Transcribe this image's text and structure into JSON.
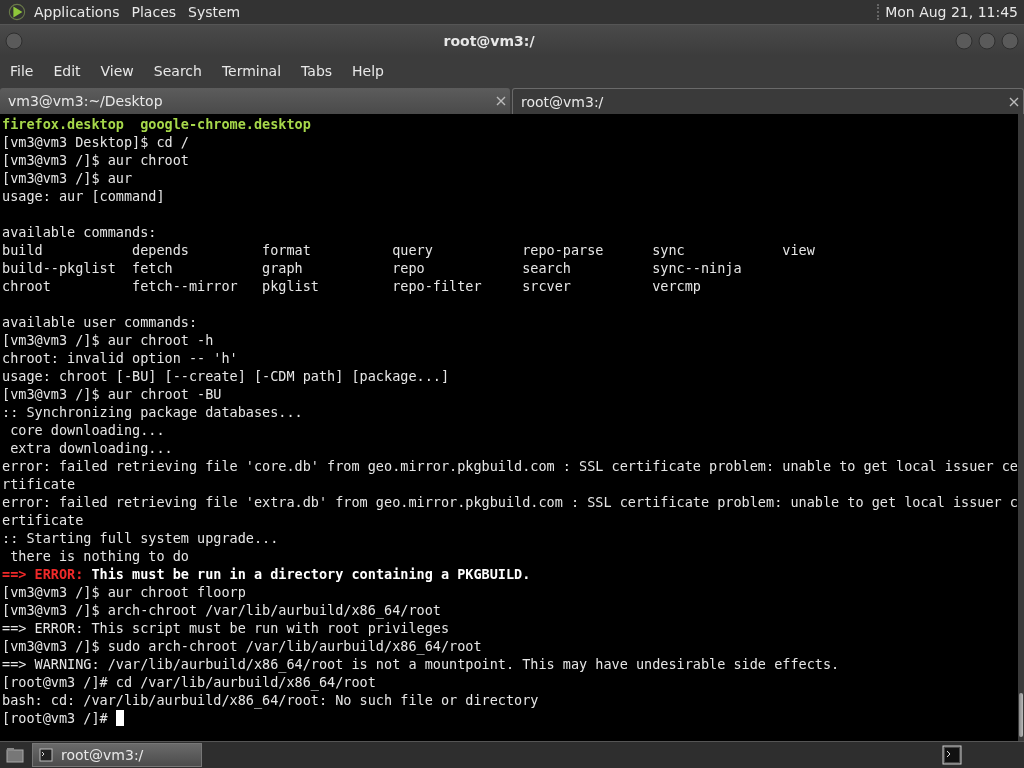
{
  "top_panel": {
    "menus": [
      "Applications",
      "Places",
      "System"
    ],
    "clock": "Mon Aug 21, 11:45"
  },
  "window": {
    "title": "root@vm3:/"
  },
  "menubar": [
    "File",
    "Edit",
    "View",
    "Search",
    "Terminal",
    "Tabs",
    "Help"
  ],
  "tabs": [
    {
      "label": "vm3@vm3:~/Desktop",
      "selected": false
    },
    {
      "label": "root@vm3:/",
      "selected": true
    }
  ],
  "terminal": {
    "lines": [
      {
        "kind": "text",
        "segments": [
          {
            "text": "firefox.desktop  google-chrome.desktop",
            "kind": "green"
          }
        ]
      },
      {
        "kind": "text",
        "segments": [
          {
            "text": "[vm3@vm3 Desktop]$ cd /",
            "kind": "normal"
          }
        ]
      },
      {
        "kind": "text",
        "segments": [
          {
            "text": "[vm3@vm3 /]$ aur chroot",
            "kind": "normal"
          }
        ]
      },
      {
        "kind": "text",
        "segments": [
          {
            "text": "[vm3@vm3 /]$ aur",
            "kind": "normal"
          }
        ]
      },
      {
        "kind": "text",
        "segments": [
          {
            "text": "usage: aur [command]",
            "kind": "normal"
          }
        ]
      },
      {
        "kind": "blank"
      },
      {
        "kind": "text",
        "segments": [
          {
            "text": "available commands:",
            "kind": "normal"
          }
        ]
      },
      {
        "kind": "text",
        "segments": [
          {
            "text": "build           depends         format          query           repo-parse      sync            view",
            "kind": "normal"
          }
        ]
      },
      {
        "kind": "text",
        "segments": [
          {
            "text": "build--pkglist  fetch           graph           repo            search          sync--ninja",
            "kind": "normal"
          }
        ]
      },
      {
        "kind": "text",
        "segments": [
          {
            "text": "chroot          fetch--mirror   pkglist         repo-filter     srcver          vercmp",
            "kind": "normal"
          }
        ]
      },
      {
        "kind": "blank"
      },
      {
        "kind": "text",
        "segments": [
          {
            "text": "available user commands:",
            "kind": "normal"
          }
        ]
      },
      {
        "kind": "text",
        "segments": [
          {
            "text": "[vm3@vm3 /]$ aur chroot -h",
            "kind": "normal"
          }
        ]
      },
      {
        "kind": "text",
        "segments": [
          {
            "text": "chroot: invalid option -- 'h'",
            "kind": "normal"
          }
        ]
      },
      {
        "kind": "text",
        "segments": [
          {
            "text": "usage: chroot [-BU] [--create] [-CDM path] [package...]",
            "kind": "normal"
          }
        ]
      },
      {
        "kind": "text",
        "segments": [
          {
            "text": "[vm3@vm3 /]$ aur chroot -BU",
            "kind": "normal"
          }
        ]
      },
      {
        "kind": "text",
        "segments": [
          {
            "text": ":: Synchronizing package databases...",
            "kind": "normal"
          }
        ]
      },
      {
        "kind": "text",
        "segments": [
          {
            "text": " core downloading...",
            "kind": "normal"
          }
        ]
      },
      {
        "kind": "text",
        "segments": [
          {
            "text": " extra downloading...",
            "kind": "normal"
          }
        ]
      },
      {
        "kind": "text",
        "segments": [
          {
            "text": "error: failed retrieving file 'core.db' from geo.mirror.pkgbuild.com : SSL certificate problem: unable to get local issuer ce",
            "kind": "normal"
          }
        ]
      },
      {
        "kind": "text",
        "segments": [
          {
            "text": "rtificate",
            "kind": "normal"
          }
        ]
      },
      {
        "kind": "text",
        "segments": [
          {
            "text": "error: failed retrieving file 'extra.db' from geo.mirror.pkgbuild.com : SSL certificate problem: unable to get local issuer c",
            "kind": "normal"
          }
        ]
      },
      {
        "kind": "text",
        "segments": [
          {
            "text": "ertificate",
            "kind": "normal"
          }
        ]
      },
      {
        "kind": "text",
        "segments": [
          {
            "text": ":: Starting full system upgrade...",
            "kind": "normal"
          }
        ]
      },
      {
        "kind": "text",
        "segments": [
          {
            "text": " there is nothing to do",
            "kind": "normal"
          }
        ]
      },
      {
        "kind": "text",
        "segments": [
          {
            "text": "==> ERROR:",
            "kind": "red"
          },
          {
            "text": " This must be run in a directory containing a PKGBUILD.",
            "kind": "bold"
          }
        ]
      },
      {
        "kind": "text",
        "segments": [
          {
            "text": "[vm3@vm3 /]$ aur chroot floorp",
            "kind": "normal"
          }
        ]
      },
      {
        "kind": "text",
        "segments": [
          {
            "text": "[vm3@vm3 /]$ arch-chroot /var/lib/aurbuild/x86_64/root",
            "kind": "normal"
          }
        ]
      },
      {
        "kind": "text",
        "segments": [
          {
            "text": "==> ERROR: This script must be run with root privileges",
            "kind": "normal"
          }
        ]
      },
      {
        "kind": "text",
        "segments": [
          {
            "text": "[vm3@vm3 /]$ sudo arch-chroot /var/lib/aurbuild/x86_64/root",
            "kind": "normal"
          }
        ]
      },
      {
        "kind": "text",
        "segments": [
          {
            "text": "==> WARNING: /var/lib/aurbuild/x86_64/root is not a mountpoint. This may have undesirable side effects.",
            "kind": "normal"
          }
        ]
      },
      {
        "kind": "text",
        "segments": [
          {
            "text": "[root@vm3 /]# cd /var/lib/aurbuild/x86_64/root",
            "kind": "normal"
          }
        ]
      },
      {
        "kind": "text",
        "segments": [
          {
            "text": "bash: cd: /var/lib/aurbuild/x86_64/root: No such file or directory",
            "kind": "normal"
          }
        ]
      },
      {
        "kind": "text",
        "segments": [
          {
            "text": "[root@vm3 /]# ",
            "kind": "normal"
          }
        ],
        "cursor": true
      }
    ]
  },
  "taskbar": {
    "windows": [
      {
        "label": "root@vm3:/",
        "selected": true
      }
    ]
  }
}
